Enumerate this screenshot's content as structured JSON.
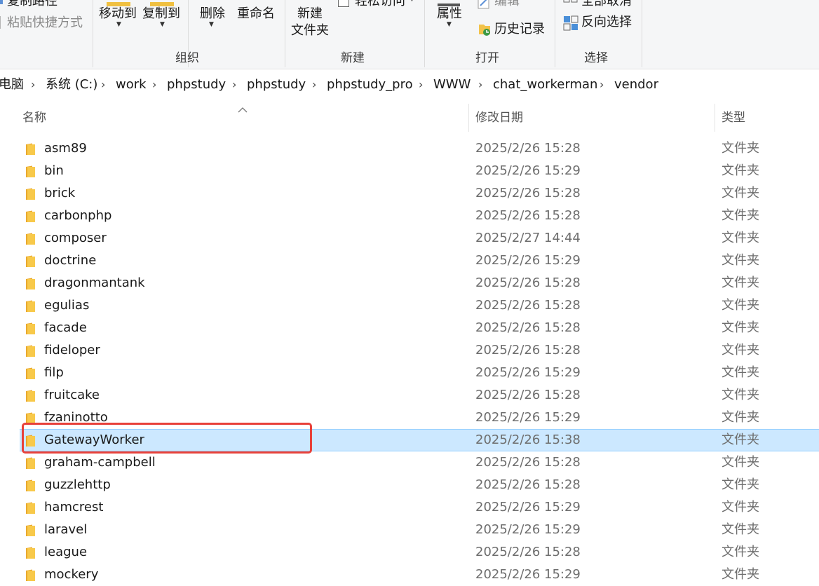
{
  "ribbon": {
    "copy_path": "复制路径",
    "paste_shortcut": "粘贴快捷方式",
    "move_to": "移动到",
    "copy_to": "复制到",
    "delete": "删除",
    "rename": "重命名",
    "new_folder_line1": "新建",
    "new_folder_line2": "文件夹",
    "easy_access": "轻松访问",
    "properties": "属性",
    "edit": "编辑",
    "history": "历史记录",
    "select_none": "全部取消",
    "invert_selection": "反向选择",
    "groups": {
      "organize": "组织",
      "new": "新建",
      "open": "打开",
      "select": "选择"
    }
  },
  "breadcrumb": [
    "电脑",
    "系统 (C:)",
    "work",
    "phpstudy",
    "phpstudy",
    "phpstudy_pro",
    "WWW",
    "chat_workerman",
    "vendor"
  ],
  "columns": {
    "name": "名称",
    "modified": "修改日期",
    "type": "类型"
  },
  "files": [
    {
      "name": "asm89",
      "date": "2025/2/26 15:28",
      "type": "文件夹"
    },
    {
      "name": "bin",
      "date": "2025/2/26 15:29",
      "type": "文件夹"
    },
    {
      "name": "brick",
      "date": "2025/2/26 15:28",
      "type": "文件夹"
    },
    {
      "name": "carbonphp",
      "date": "2025/2/26 15:28",
      "type": "文件夹"
    },
    {
      "name": "composer",
      "date": "2025/2/27 14:44",
      "type": "文件夹"
    },
    {
      "name": "doctrine",
      "date": "2025/2/26 15:29",
      "type": "文件夹"
    },
    {
      "name": "dragonmantank",
      "date": "2025/2/26 15:28",
      "type": "文件夹"
    },
    {
      "name": "egulias",
      "date": "2025/2/26 15:28",
      "type": "文件夹"
    },
    {
      "name": "facade",
      "date": "2025/2/26 15:28",
      "type": "文件夹"
    },
    {
      "name": "fideloper",
      "date": "2025/2/26 15:28",
      "type": "文件夹"
    },
    {
      "name": "filp",
      "date": "2025/2/26 15:29",
      "type": "文件夹"
    },
    {
      "name": "fruitcake",
      "date": "2025/2/26 15:28",
      "type": "文件夹"
    },
    {
      "name": "fzaninotto",
      "date": "2025/2/26 15:29",
      "type": "文件夹"
    },
    {
      "name": "GatewayWorker",
      "date": "2025/2/26 15:38",
      "type": "文件夹",
      "selected": true
    },
    {
      "name": "graham-campbell",
      "date": "2025/2/26 15:28",
      "type": "文件夹"
    },
    {
      "name": "guzzlehttp",
      "date": "2025/2/26 15:28",
      "type": "文件夹"
    },
    {
      "name": "hamcrest",
      "date": "2025/2/26 15:29",
      "type": "文件夹"
    },
    {
      "name": "laravel",
      "date": "2025/2/26 15:29",
      "type": "文件夹"
    },
    {
      "name": "league",
      "date": "2025/2/26 15:28",
      "type": "文件夹"
    },
    {
      "name": "mockery",
      "date": "2025/2/26 15:29",
      "type": "文件夹"
    }
  ],
  "colors": {
    "selection": "#cce8ff",
    "annotation": "#e8413a",
    "folder": "#f8c94a"
  }
}
